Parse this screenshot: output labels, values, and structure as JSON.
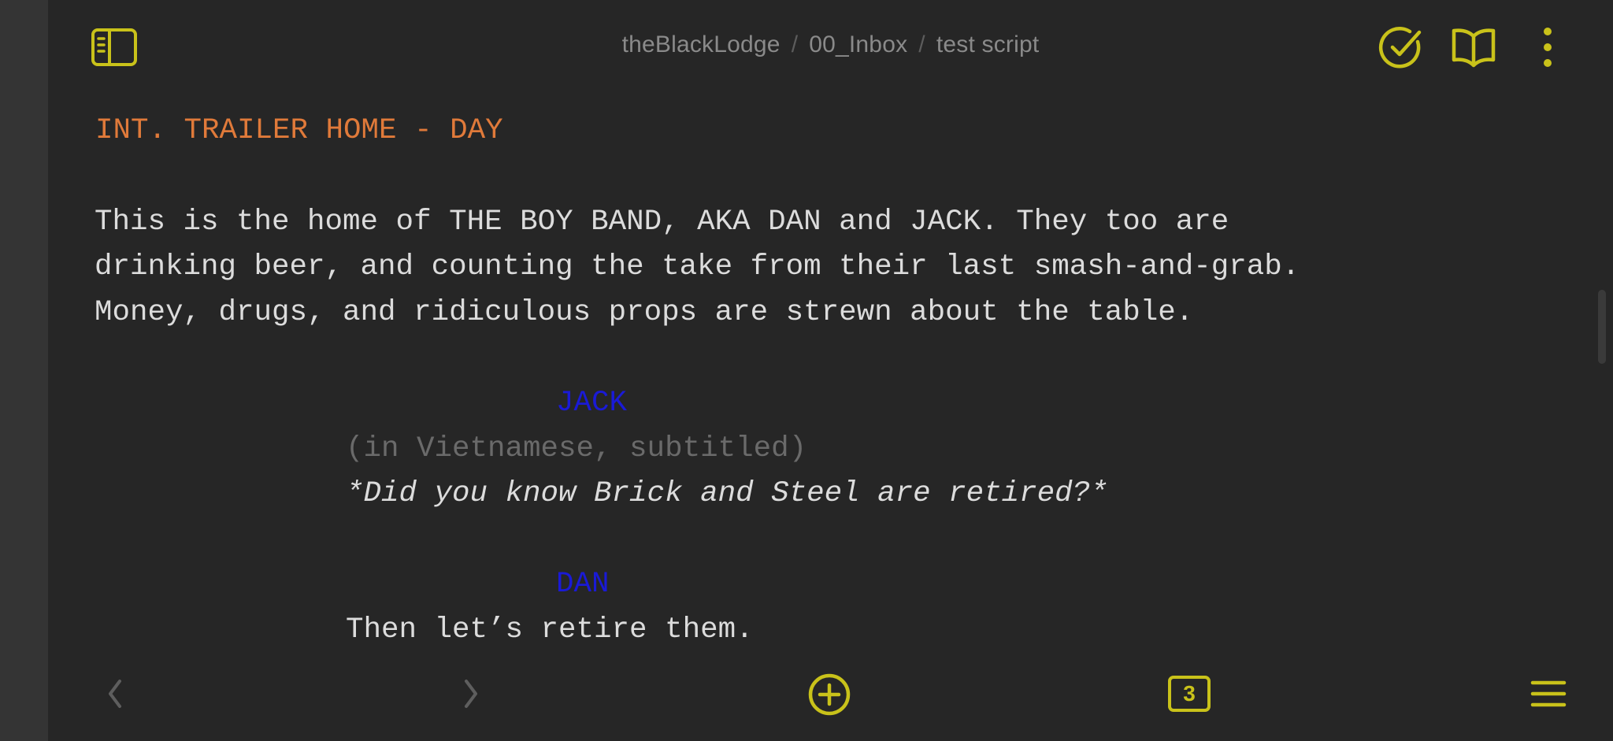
{
  "breadcrumb": {
    "vault": "theBlackLodge",
    "folder": "00_Inbox",
    "file": "test script",
    "separator": "/"
  },
  "toolbar": {
    "sidebar_toggle_icon": "sidebar-toggle-icon",
    "check_icon": "check-circle-icon",
    "reading_view_icon": "open-book-icon",
    "more_icon": "more-vertical-icon"
  },
  "script": {
    "scene_heading": "INT. TRAILER HOME - DAY",
    "action": [
      "This is the home of THE BOY BAND, AKA DAN and JACK. They too are",
      "drinking beer, and counting the take from their last smash-and-grab.",
      "Money, drugs, and ridiculous props are strewn about the table."
    ],
    "character1": "JACK",
    "parenthetical1": "(in Vietnamese, subtitled)",
    "dialogue1": "*Did you know Brick and Steel are retired?*",
    "character2": "DAN",
    "dialogue2": "Then let’s retire them."
  },
  "bottombar": {
    "back_icon": "chevron-left-icon",
    "forward_icon": "chevron-right-icon",
    "new_icon": "plus-circle-icon",
    "tab_count": "3",
    "menu_icon": "hamburger-menu-icon"
  },
  "colors": {
    "accent": "#c9c21a",
    "scene_heading": "#e07a3a",
    "character": "#1a1ad6",
    "parenthetical": "#6a6a6a",
    "text": "#dcdcdc",
    "background": "#262626",
    "rail": "#343434"
  }
}
